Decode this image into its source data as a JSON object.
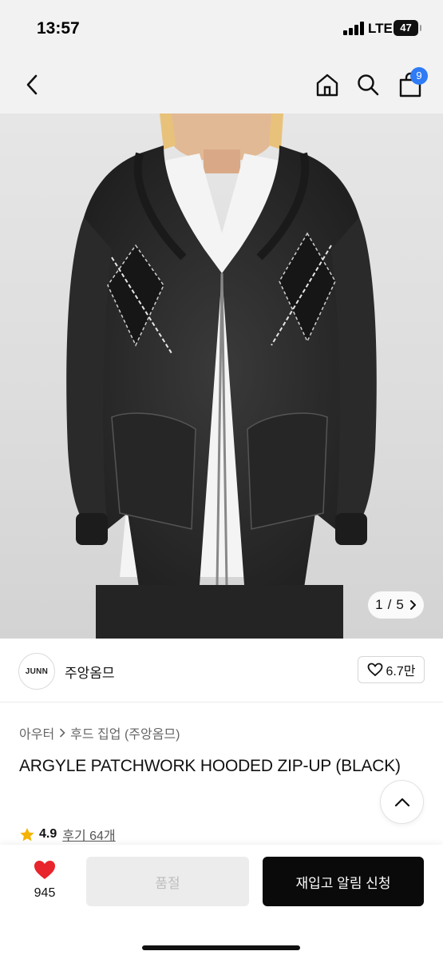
{
  "status_bar": {
    "time": "13:57",
    "network": "LTE",
    "battery": "47"
  },
  "nav": {
    "cart_count": "9",
    "icons": [
      "back-icon",
      "home-icon",
      "search-icon",
      "cart-icon"
    ]
  },
  "gallery": {
    "current": "1",
    "separator": "/",
    "total": "5"
  },
  "brand": {
    "logo_text": "JUNN",
    "name": "주앙옴므",
    "likes": "6.7만"
  },
  "product": {
    "breadcrumb": [
      "아우터",
      "후드 집업 (주앙옴므)"
    ],
    "title": "ARGYLE PATCHWORK HOODED ZIP-UP (BLACK)",
    "rating": "4.9",
    "reviews": "후기 64개"
  },
  "bottom_bar": {
    "wish_count": "945",
    "soldout_label": "품절",
    "restock_label": "재입고 알림 신청"
  },
  "colors": {
    "accent_blue": "#2f7bf5",
    "heart_red": "#e8242c",
    "star_yellow": "#f5b301",
    "primary_button": "#0a0a0a"
  }
}
